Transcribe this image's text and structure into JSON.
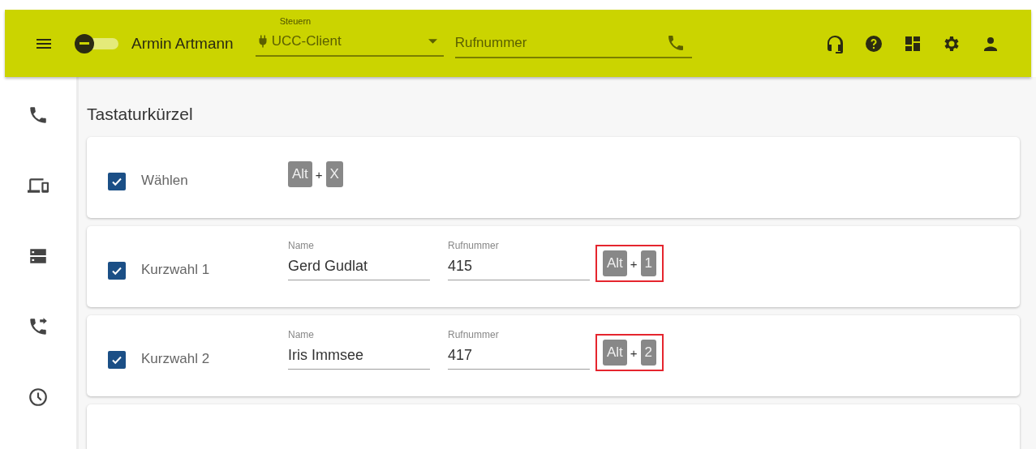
{
  "header": {
    "user_name": "Armin Artmann",
    "status_toggle": {
      "on": false
    },
    "control_select": {
      "label": "Steuern",
      "value": "UCC-Client"
    },
    "dial_field": {
      "placeholder": "Rufnummer"
    }
  },
  "sidebar": {
    "items": [
      {
        "selected": false
      },
      {
        "selected": false
      },
      {
        "selected": false
      },
      {
        "selected": false
      },
      {
        "selected": false
      }
    ]
  },
  "page_title": "Tastaturkürzel",
  "shortcuts": [
    {
      "kind": "plain",
      "label": "Wählen",
      "checked": true,
      "keys": [
        "Alt",
        "X"
      ],
      "joiner": "+",
      "highlighted": false
    },
    {
      "kind": "speed_dial",
      "label": "Kurzwahl 1",
      "checked": true,
      "name_label": "Name",
      "name": "Gerd Gudlat",
      "number_label": "Rufnummer",
      "number": "415",
      "keys": [
        "Alt",
        "1"
      ],
      "joiner": "+",
      "highlighted": true
    },
    {
      "kind": "speed_dial",
      "label": "Kurzwahl 2",
      "checked": true,
      "name_label": "Name",
      "name": "Iris Immsee",
      "number_label": "Rufnummer",
      "number": "417",
      "keys": [
        "Alt",
        "2"
      ],
      "joiner": "+",
      "highlighted": true
    }
  ]
}
